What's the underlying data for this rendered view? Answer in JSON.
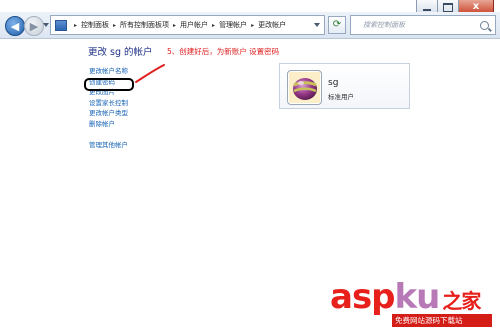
{
  "window": {
    "controls": {
      "minimize": "",
      "maximize": "",
      "close": "x"
    }
  },
  "address_bar": {
    "breadcrumbs": [
      "控制面板",
      "所有控制面板项",
      "用户帐户",
      "管理帐户",
      "更改帐户"
    ],
    "separator": "▸"
  },
  "search": {
    "placeholder": "搜索控制面板"
  },
  "left_pane": {
    "title": "更改 sg 的帐户",
    "tasks": [
      "更改帐户名称",
      "创建密码",
      "更改图片",
      "设置家长控制",
      "更改帐户类型",
      "删除帐户"
    ],
    "other": "管理其他帐户"
  },
  "annotation": {
    "text": "5、创建好后，为新账户  设置密码",
    "color": "#e02020"
  },
  "account": {
    "name": "sg",
    "type": "标准用户",
    "icon": "user-picture-icon"
  },
  "watermark": {
    "logo_main": "asp",
    "logo_tail": "ku",
    "logo_cn": "之家",
    "sub": "免费网站源码下载站"
  },
  "colors": {
    "link": "#1562b5",
    "title": "#1e3287",
    "annotation": "#e02020"
  }
}
